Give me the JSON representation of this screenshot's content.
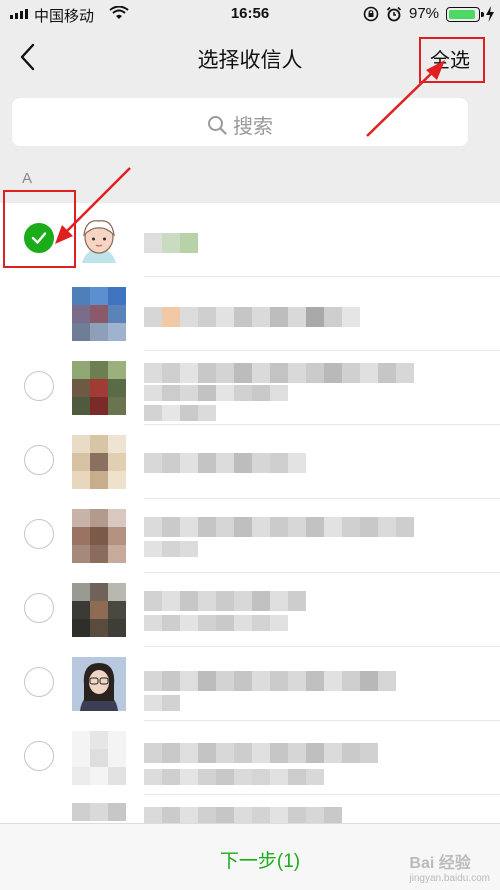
{
  "status_bar": {
    "carrier": "中国移动",
    "time": "16:56",
    "battery_percent": "97%",
    "battery_level": 0.97
  },
  "nav": {
    "back_icon": "chevron-left-icon",
    "title": "选择收信人",
    "select_all": "全选"
  },
  "search": {
    "placeholder": "搜索",
    "icon": "search-icon"
  },
  "section_letter": "A",
  "contacts": [
    {
      "checked": true
    },
    {
      "checked": false
    },
    {
      "checked": false
    },
    {
      "checked": false
    },
    {
      "checked": false
    },
    {
      "checked": false
    },
    {
      "checked": false
    },
    {
      "checked": false
    },
    {
      "checked": false
    }
  ],
  "bottom": {
    "next_label": "下一步(1)"
  },
  "watermark": {
    "brand": "Bai 经验",
    "url": "jingyan.baidu.com"
  },
  "colors": {
    "accent_green": "#1aad19",
    "annotation_red": "#e02020"
  }
}
